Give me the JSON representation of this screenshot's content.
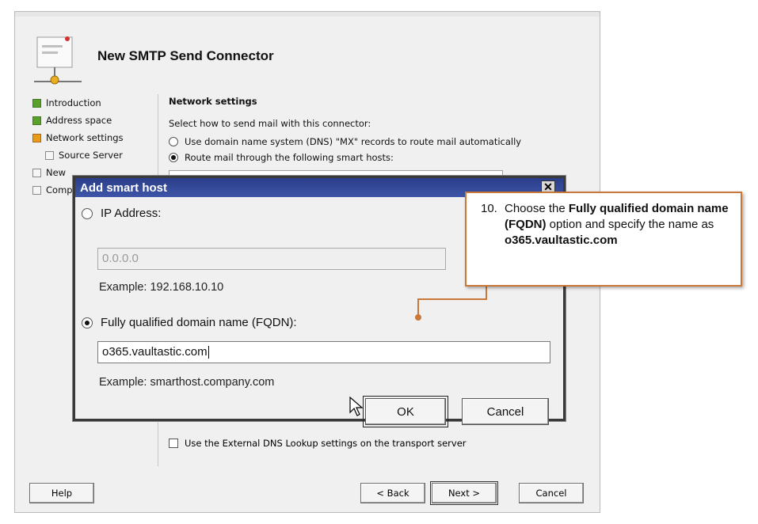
{
  "wizard": {
    "title": "New SMTP Send Connector",
    "nav": [
      {
        "label": "Introduction",
        "status": "done"
      },
      {
        "label": "Address space",
        "status": "done"
      },
      {
        "label": "Network settings",
        "status": "current"
      },
      {
        "label": "Source Server",
        "status": "todo"
      },
      {
        "label": "New",
        "status": "todo"
      },
      {
        "label": "Comp",
        "status": "todo"
      }
    ],
    "section_title": "Network settings",
    "description": "Select how to send mail with this connector:",
    "options": {
      "dns": "Use domain name system (DNS) \"MX\" records to route mail automatically",
      "smart_hosts": "Route mail through the following smart hosts:"
    },
    "dns_lookup_checkbox": "Use the External DNS Lookup settings on the transport server",
    "buttons": {
      "help": "Help",
      "back": "< Back",
      "next": "Next >",
      "cancel": "Cancel"
    }
  },
  "dialog": {
    "title": "Add smart host",
    "close": "✕",
    "ip_label": "IP Address:",
    "ip_value": "0.0.0.0",
    "ip_example": "Example: 192.168.10.10",
    "fqdn_label": "Fully qualified domain name (FQDN):",
    "fqdn_value": "o365.vaultastic.com",
    "fqdn_example": "Example: smarthost.company.com",
    "ok": "OK",
    "cancel": "Cancel"
  },
  "callout": {
    "number": "10.",
    "t1": "Choose the ",
    "b1": "Fully qualified domain name (FQDN)",
    "t2": " option and specify the name as ",
    "b2": "o365.vaultastic.com",
    "border_color": "#c9783a"
  },
  "colors": {
    "titlebar": "#2a3d8a",
    "nav_done": "#5aa02c",
    "nav_current": "#e89a1a"
  }
}
